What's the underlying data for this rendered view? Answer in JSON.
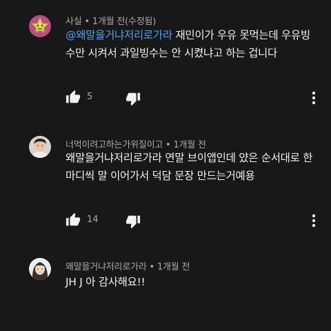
{
  "comments": [
    {
      "author": "사실",
      "separator": " • ",
      "time": "1개월 전(수정됨)",
      "mention": "@왜말을거냐저리로가라",
      "text_after_mention": " 재민이가 우유 못먹는데 우유빙수만 시켜서 과일빙수는 안 시켰냐고 하는 겁니다",
      "likes": "5",
      "avatar_icon": "star-face-avatar-icon"
    },
    {
      "author": "너먹이려고하는가위질이고",
      "separator": " • ",
      "time": "1개월 전",
      "text": "왜말을거냐저리로가라 연말 브이앱인데 얐은 순서대로 한마디씩 말 이어가서 덕담 문장 만드는거예용",
      "likes": "14",
      "avatar_icon": "person-photo-avatar-icon"
    },
    {
      "author": "왜말을거냐저리로가라",
      "separator": " • ",
      "time": "1개월 전",
      "text": "JH J 아 감사해요!!",
      "avatar_icon": "girl-photo-avatar-icon"
    }
  ],
  "colors": {
    "background": "#181818",
    "text": "#f1f1f1",
    "secondary": "#aaaaaa",
    "mention": "#3ea6ff"
  }
}
